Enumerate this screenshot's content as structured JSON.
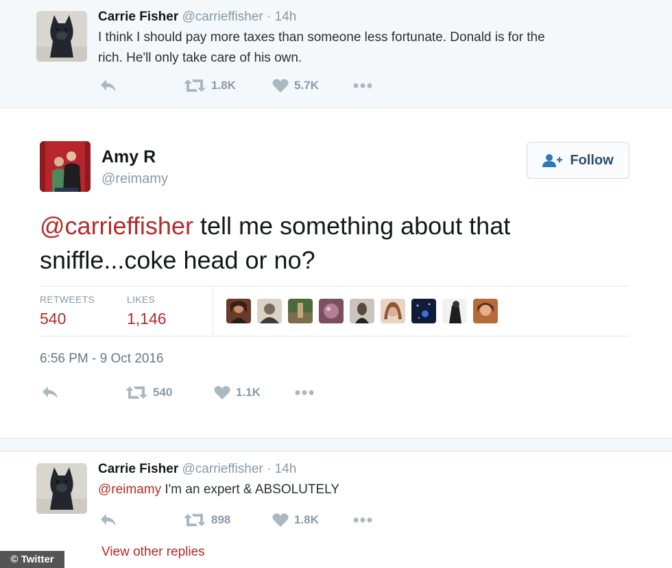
{
  "top_tweet": {
    "name": "Carrie Fisher",
    "handle": "@carrieffisher",
    "separator": "·",
    "time": "14h",
    "text_line1": "I think I should pay more taxes than someone less fortunate. Donald is for the",
    "text_line2": "rich. He'll only take care of his own.",
    "retweets": "1.8K",
    "likes": "5.7K"
  },
  "main_tweet": {
    "name": "Amy R",
    "handle": "@reimamy",
    "follow_label": "Follow",
    "mention": "@carrieffisher",
    "text_rest": " tell me something about that sniffle...coke head or no?",
    "retweets_label": "RETWEETS",
    "retweets_value": "540",
    "likes_label": "LIKES",
    "likes_value": "1,146",
    "timestamp": "6:56 PM - 9 Oct 2016",
    "action_retweets": "540",
    "action_likes": "1.1K"
  },
  "reply_tweet": {
    "name": "Carrie Fisher",
    "handle": "@carrieffisher",
    "separator": "·",
    "time": "14h",
    "mention": "@reimamy",
    "text_rest": " I'm an expert & ABSOLUTELY",
    "retweets": "898",
    "likes": "1.8K",
    "view_replies": "View other replies"
  },
  "watermark": "© Twitter",
  "colors": {
    "mention": "#b32a2a",
    "muted": "#8899a6",
    "icon": "#aab8c2",
    "card_bg": "#f5f8fa"
  },
  "icons": [
    "reply-icon",
    "retweet-icon",
    "heart-icon",
    "more-icon",
    "follow-user-icon"
  ]
}
